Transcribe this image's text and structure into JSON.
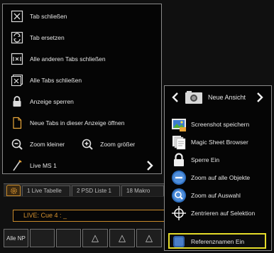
{
  "context_menu": {
    "items": [
      {
        "label": "Tab schließen",
        "icon": "tab-close-icon"
      },
      {
        "label": "Tab ersetzen",
        "icon": "tab-replace-icon"
      },
      {
        "label": "Alle anderen Tabs schließen",
        "icon": "close-other-tabs-icon"
      },
      {
        "label": "Alle Tabs schließen",
        "icon": "close-all-tabs-icon"
      },
      {
        "label": "Anzeige sperren",
        "icon": "lock-icon"
      },
      {
        "label": "Neue Tabs in dieser Anzeige öffnen",
        "icon": "new-document-icon"
      }
    ],
    "zoom_out": "Zoom kleiner",
    "zoom_in": "Zoom größer",
    "live": "Live MS 1"
  },
  "background": {
    "tabs": [
      "1 Live Tabelle",
      "2 PSD Liste 1",
      "18 Makro"
    ],
    "command_line": "LIVE: Cue  4 : _",
    "key_label": "Alle NP",
    "key_triangle": "△"
  },
  "view_menu": {
    "title": "Neue Ansicht",
    "items": [
      {
        "label": "Screenshot speichern",
        "icon": "screenshot-icon"
      },
      {
        "label": "Magic Sheet Browser",
        "icon": "magic-sheet-icon"
      },
      {
        "label": "Sperre Ein",
        "icon": "lock-icon"
      },
      {
        "label": "Zoom auf alle Objekte",
        "icon": "zoom-all-icon"
      },
      {
        "label": "Zoom auf Auswahl",
        "icon": "zoom-selection-icon"
      },
      {
        "label": "Zentrieren auf Selektion",
        "icon": "center-selection-icon"
      },
      {
        "label": "Referenznamen Ein",
        "icon": "reference-names-icon"
      }
    ]
  },
  "colors": {
    "accent_orange": "#d4902e",
    "highlight_yellow": "#e4dc2a"
  }
}
